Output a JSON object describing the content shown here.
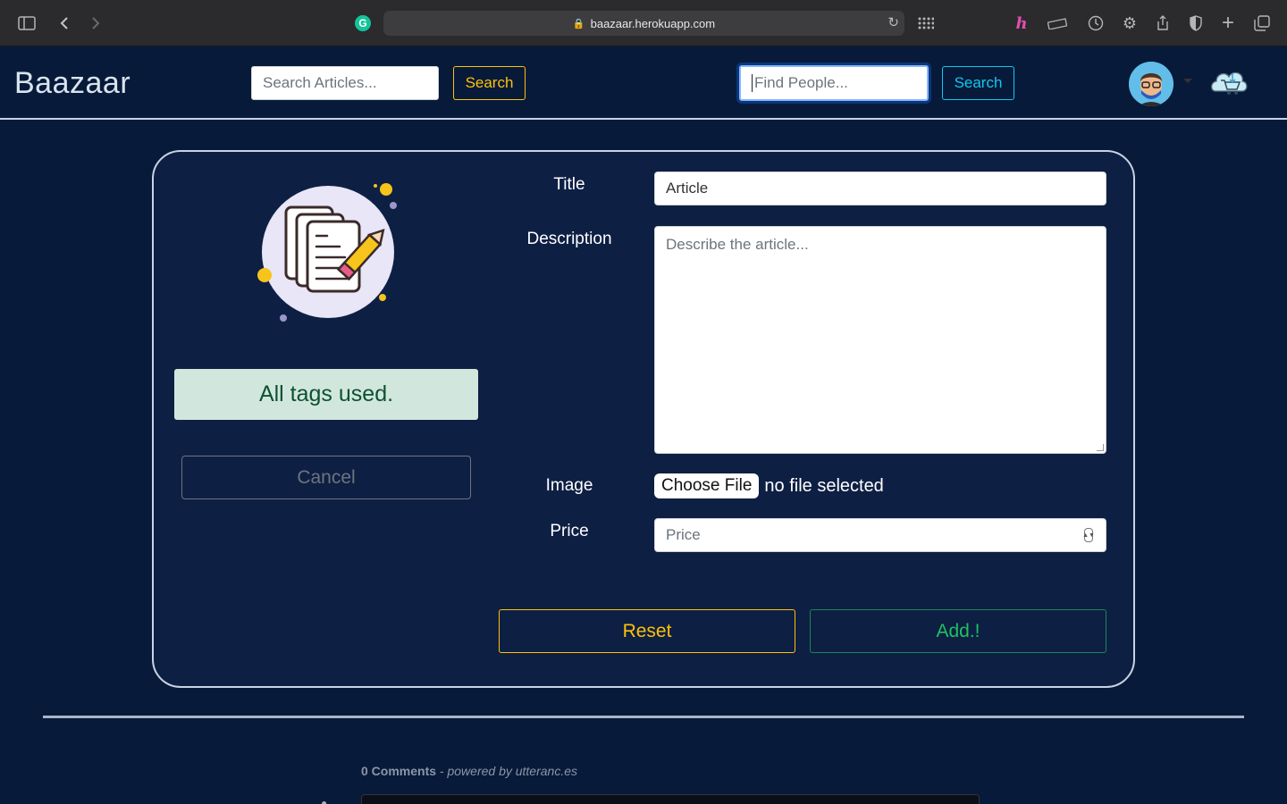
{
  "browser": {
    "url": "baazaar.herokuapp.com"
  },
  "navbar": {
    "brand": "Baazaar",
    "article_search_placeholder": "Search Articles...",
    "article_search_button": "Search",
    "people_search_placeholder": "Find People...",
    "people_search_button": "Search"
  },
  "form": {
    "tags_alert": "All tags used.",
    "cancel_label": "Cancel",
    "title_label": "Title",
    "title_value": "Article",
    "description_label": "Description",
    "description_placeholder": "Describe the article...",
    "image_label": "Image",
    "choose_file_label": "Choose File",
    "file_status": "no file selected",
    "price_label": "Price",
    "price_placeholder": "Price",
    "reset_label": "Reset",
    "add_label": "Add.!"
  },
  "comments": {
    "count": "0 Comments",
    "powered_by": "- powered by utteranc.es"
  },
  "colors": {
    "background": "#081a3a",
    "card": "#0e1f44",
    "yellow": "#ffc107",
    "green": "#198754",
    "teal": "#0dcaf0",
    "alert_bg": "#d1e7dd"
  }
}
